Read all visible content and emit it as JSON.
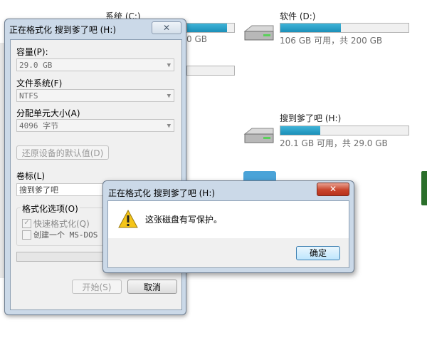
{
  "explorer": {
    "drive_c": {
      "name": "系统 (C:)",
      "info_fragment": "0 GB"
    },
    "drive_d": {
      "name": "软件 (D:)",
      "info": "106 GB 可用，共 200 GB",
      "used_fraction": 0.47
    },
    "drive_h": {
      "name": "搜到爹了吧 (H:)",
      "info": "20.1 GB 可用，共 29.0 GB",
      "used_fraction": 0.31
    },
    "drive_c_used_fraction": 0.85
  },
  "format_dialog": {
    "title": "正在格式化 搜到爹了吧 (H:)",
    "close_label": "✕",
    "capacity_label": "容量(P):",
    "capacity_value": "29.0 GB",
    "filesystem_label": "文件系统(F)",
    "filesystem_value": "NTFS",
    "alloc_label": "分配单元大小(A)",
    "alloc_value": "4096 字节",
    "restore_defaults": "还原设备的默认值(D)",
    "volume_label": "卷标(L)",
    "volume_value": "搜到爹了吧",
    "options_label": "格式化选项(O)",
    "quick_format": "快速格式化(Q)",
    "msdos_disk": "创建一个 MS-DOS 启",
    "start_button": "开始(S)",
    "cancel_button": "取消"
  },
  "warning_dialog": {
    "title": "正在格式化 搜到爹了吧 (H:)",
    "close_label": "✕",
    "message": "这张磁盘有写保护。",
    "ok_button": "确定"
  }
}
